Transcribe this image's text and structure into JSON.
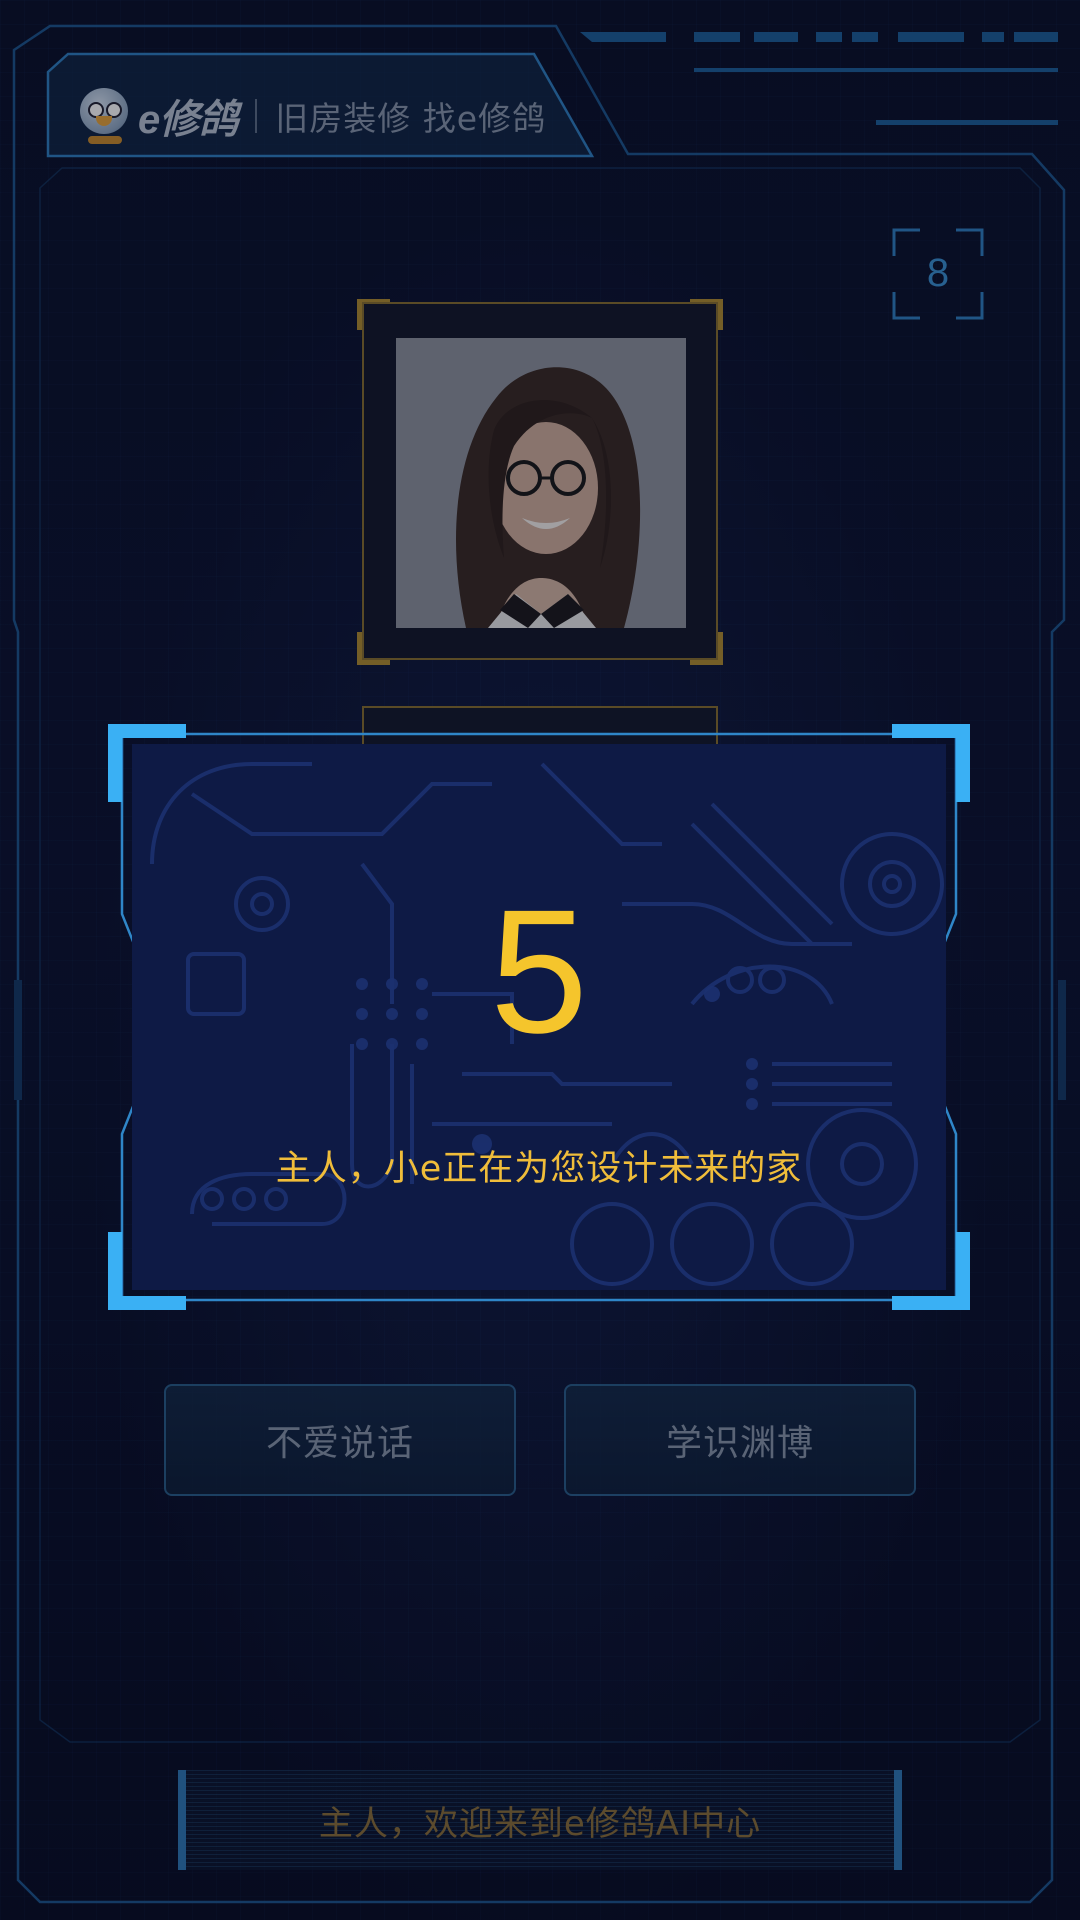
{
  "header": {
    "logo_text": "e修鸽",
    "slogan": "旧房装修 找e修鸽"
  },
  "timer": {
    "value": "8"
  },
  "profile": {
    "portrait_icon": "woman-with-glasses-portrait"
  },
  "traits": {
    "left_label": "不爱说话",
    "right_label": "学识渊博"
  },
  "welcome": {
    "text": "主人，欢迎来到e修鸽AI中心"
  },
  "modal": {
    "countdown": "5",
    "message": "主人，小e正在为您设计未来的家"
  },
  "colors": {
    "accent_blue": "#3ab0f4",
    "frame_blue": "#2f7fc0",
    "gold": "#f5c52c",
    "gold_frame": "#b08c30"
  }
}
